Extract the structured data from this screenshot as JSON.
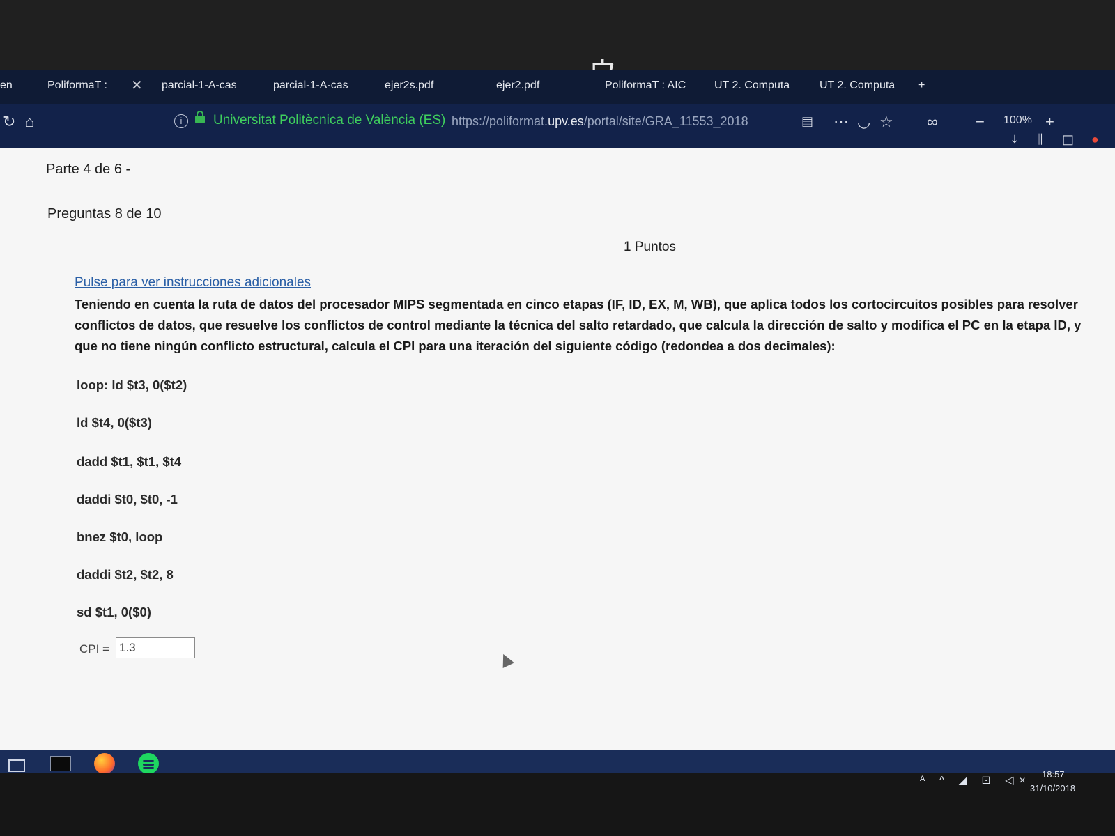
{
  "bezel": {
    "logo_glyph": "ウ"
  },
  "browser": {
    "tabs": [
      {
        "label": "en"
      },
      {
        "label": "PoliformaT :"
      },
      {
        "label": "parcial-1-A-cas"
      },
      {
        "label": "parcial-1-A-cas"
      },
      {
        "label": "ejer2s.pdf"
      },
      {
        "label": "ejer2.pdf"
      },
      {
        "label": "PoliformaT : AIC"
      },
      {
        "label": "UT 2. Computa"
      },
      {
        "label": "UT 2. Computa"
      }
    ],
    "close_glyph": "✕",
    "site_identity": "Universitat Politècnica de València (ES)",
    "url_prefix": "https://poliformat.",
    "url_domain": "upv.es",
    "url_path": "/portal/site/GRA_11553_2018",
    "zoom": "100%",
    "new_tab_glyph": "+",
    "zoom_minus_glyph": "−",
    "zoom_plus_glyph": "+"
  },
  "quiz": {
    "part": "Parte 4 de 6 -",
    "questions": "Preguntas 8 de 10",
    "points": "1 Puntos",
    "instructions_link": "Pulse para ver instrucciones adicionales",
    "question_text": "Teniendo en cuenta la ruta de datos del procesador MIPS segmentada en cinco etapas (IF, ID, EX, M, WB), que aplica todos los cortocircuitos posibles para resolver conflictos de datos, que resuelve los conflictos de control mediante la técnica del salto retardado, que calcula la dirección de salto y modifica el PC en la etapa ID, y que no tiene ningún conflicto estructural, calcula el CPI para una iteración del siguiente código (redondea a dos decimales):",
    "code_lines": [
      "loop: ld $t3, 0($t2)",
      "ld $t4, 0($t3)",
      "dadd $t1, $t1, $t4",
      "daddi $t0, $t0, -1",
      "bnez $t0, loop",
      "daddi $t2, $t2, 8",
      "sd $t1, 0($0)"
    ],
    "cpi_label": "CPI =",
    "cpi_value": "1.3"
  },
  "taskbar": {
    "time": "18:57",
    "date": "31/10/2018",
    "tray_glyphs": "ᴬ ^ ◢ ⊡ ◁×"
  }
}
